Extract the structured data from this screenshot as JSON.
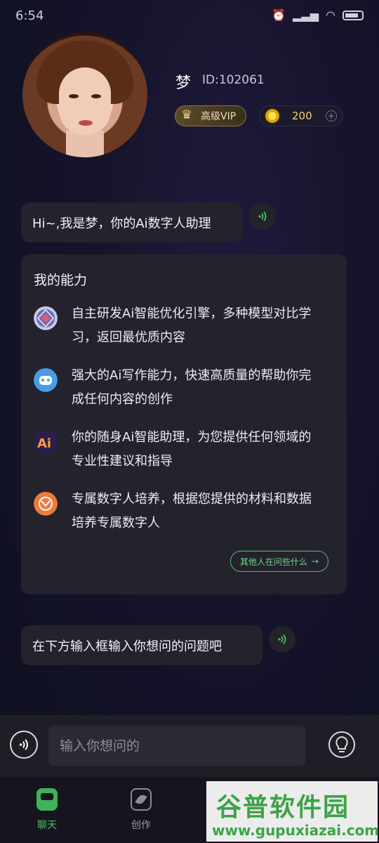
{
  "status_bar": {
    "time": "6:54"
  },
  "profile": {
    "name": "梦",
    "id_text": "ID:102061",
    "vip_label": "高级VIP",
    "coins": "200",
    "coin_plus": "+"
  },
  "greeting": {
    "text": "Hi~,我是梦，你的Ai数字人助理"
  },
  "abilities": {
    "title": "我的能力",
    "items": [
      {
        "icon": "globe-engine-icon",
        "text": "自主研发Ai智能优化引擎，多种模型对比学习，返回最优质内容"
      },
      {
        "icon": "robot-icon",
        "text": "强大的Ai写作能力，快速高质量的帮助你完成任何内容的创作"
      },
      {
        "icon": "ai-logo-icon",
        "text": "你的随身Ai智能助理，为您提供任何领域的专业性建议和指导"
      },
      {
        "icon": "digital-human-icon",
        "text": "专属数字人培养，根据您提供的材料和数据培养专属数字人"
      }
    ],
    "others_button": "其他人在问些什么"
  },
  "prompt": {
    "text": "在下方输入框输入你想问的问题吧"
  },
  "input": {
    "placeholder": "输入你想问的"
  },
  "tabs": [
    {
      "label": "聊天",
      "active": true
    },
    {
      "label": "创作",
      "active": false
    }
  ],
  "watermark": {
    "title": "谷普软件园",
    "url": "www.gupuxiazai.com"
  },
  "colors": {
    "accent": "#4cc06a",
    "bubble": "#23222d",
    "background": "#15132a"
  }
}
